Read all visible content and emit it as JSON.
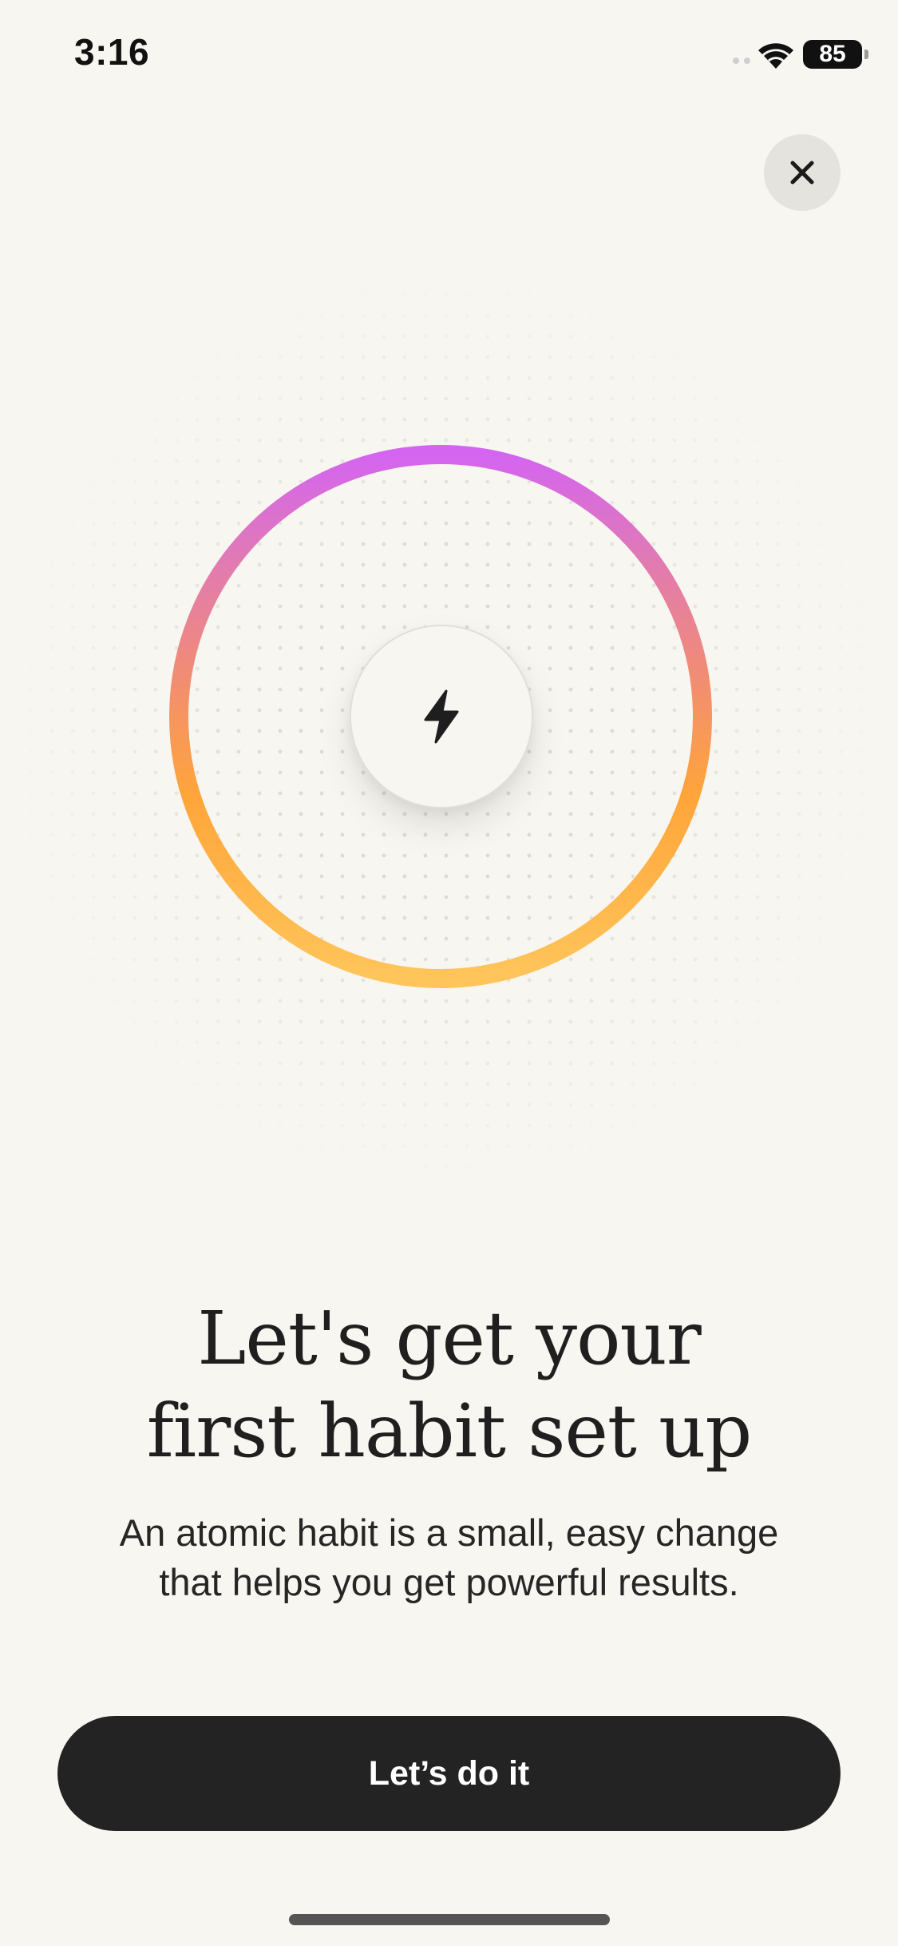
{
  "status_bar": {
    "time": "3:16",
    "battery": "85",
    "icons": [
      "cellular-signal-icon",
      "wifi-icon",
      "battery-icon"
    ]
  },
  "close_icon": "close-icon",
  "illustration": {
    "center_icon": "lightning-bolt-icon",
    "ring_gradient": [
      "#ffc55a",
      "#ffa53a",
      "#f08a7a",
      "#e07ab4",
      "#d465f0"
    ],
    "progress": 1.0
  },
  "onboarding": {
    "headline_line1": "Let's get your",
    "headline_line2": "first habit set up",
    "subtext_line1": "An atomic habit is a small, easy change",
    "subtext_line2": "that helps you get powerful results."
  },
  "cta": {
    "label": "Let’s do it"
  },
  "colors": {
    "background": "#f8f6f1",
    "button": "#232323",
    "button_text": "#ffffff",
    "text": "#222222"
  }
}
